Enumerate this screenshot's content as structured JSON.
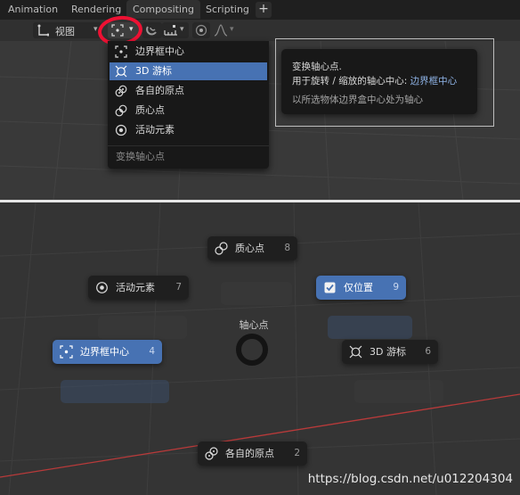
{
  "tabs": [
    "Animation",
    "Rendering",
    "Compositing",
    "Scripting"
  ],
  "tab_plus": "+",
  "header": {
    "view_label": "视图"
  },
  "menu": {
    "items": [
      {
        "label": "边界框中心",
        "icon": "bounding-box-center-icon"
      },
      {
        "label": "3D 游标",
        "icon": "3d-cursor-icon",
        "highlighted": true
      },
      {
        "label": "各自的原点",
        "icon": "individual-origins-icon"
      },
      {
        "label": "质心点",
        "icon": "median-point-icon"
      },
      {
        "label": "活动元素",
        "icon": "active-element-icon"
      }
    ],
    "footer": "变换轴心点"
  },
  "tooltip": {
    "line1": "变换轴心点.",
    "line2_prefix": "用于旋转 / 缩放的轴心中心:",
    "line2_value": "边界框中心",
    "line3": "以所选物体边界盒中心处为轴心"
  },
  "pie": {
    "title": "轴心点",
    "items": {
      "median": {
        "label": "质心点",
        "num": "8"
      },
      "active": {
        "label": "活动元素",
        "num": "7"
      },
      "only_location": {
        "label": "仅位置",
        "num": "9",
        "checked": true
      },
      "bbox": {
        "label": "边界框中心",
        "num": "4"
      },
      "cursor": {
        "label": "3D 游标",
        "num": "6"
      },
      "individual": {
        "label": "各自的原点",
        "num": "2"
      }
    }
  },
  "colors": {
    "accent": "#4772b3",
    "highlight_circle": "#ee1133",
    "axis_red": "#b83a3a"
  },
  "watermark": "https://blog.csdn.net/u012204304"
}
